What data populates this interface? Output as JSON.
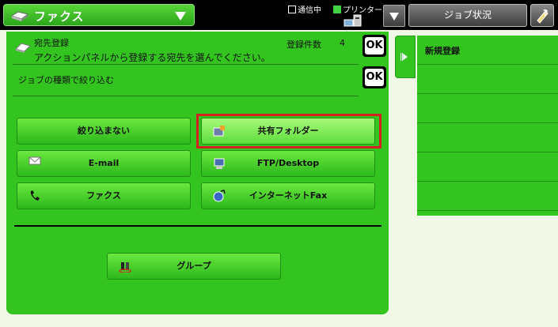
{
  "header": {
    "mode_label": "ファクス",
    "status_comm": "通信中",
    "status_printer": "プリンター",
    "job_status_label": "ジョブ状況"
  },
  "panel": {
    "section_title": "宛先登録",
    "instruction": "アクションパネルから登録する宛先を選んでください。",
    "count_label": "登録件数",
    "count_value": "4",
    "ok_label": "OK",
    "filter_title": "ジョブの種類で絞り込む",
    "buttons": [
      {
        "label": "絞り込まない",
        "icon": "none"
      },
      {
        "label": "共有フォルダー",
        "icon": "shared-folder-icon",
        "selected": true
      },
      {
        "label": "E-mail",
        "icon": "envelope-icon"
      },
      {
        "label": "FTP/Desktop",
        "icon": "ftp-desktop-icon"
      },
      {
        "label": "ファクス",
        "icon": "phone-icon"
      },
      {
        "label": "インターネットFax",
        "icon": "internet-fax-icon"
      },
      {
        "label": "グループ",
        "icon": "group-icon"
      }
    ]
  },
  "action_panel": {
    "items": [
      {
        "label": "新規登録"
      },
      {
        "label": ""
      },
      {
        "label": ""
      },
      {
        "label": ""
      },
      {
        "label": ""
      },
      {
        "label": ""
      }
    ]
  },
  "colors": {
    "accent_green": "#33c41f",
    "selection_red": "#d42020",
    "background": "#f1f8e6"
  }
}
